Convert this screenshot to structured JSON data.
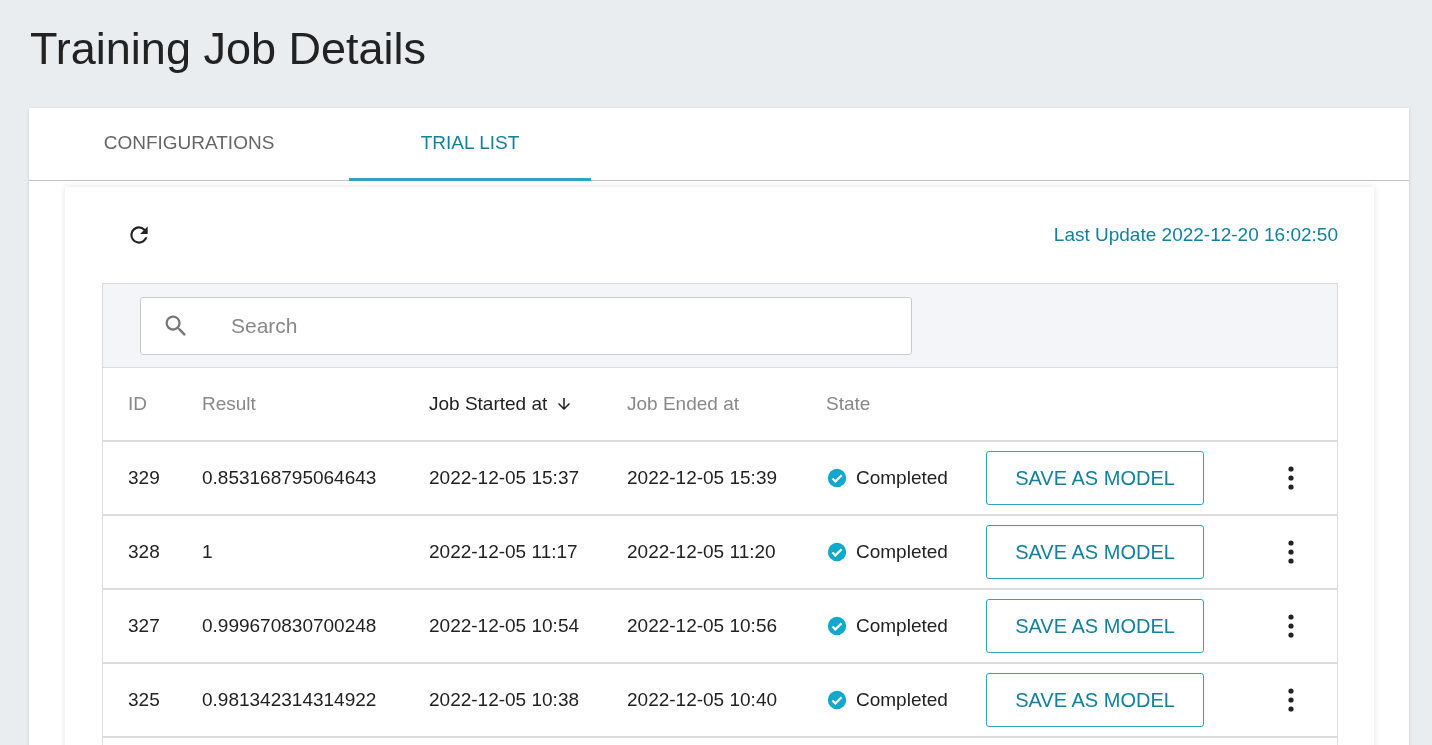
{
  "page": {
    "title": "Training Job Details"
  },
  "tabs": [
    {
      "label": "CONFIGURATIONS",
      "selected": false
    },
    {
      "label": "TRIAL LIST",
      "selected": true
    }
  ],
  "toolbar": {
    "last_update": "Last Update 2022-12-20 16:02:50"
  },
  "search": {
    "placeholder": "Search"
  },
  "table": {
    "columns": [
      {
        "label": "ID",
        "sorted": false
      },
      {
        "label": "Result",
        "sorted": false
      },
      {
        "label": "Job Started at",
        "sorted": true
      },
      {
        "label": "Job Ended at",
        "sorted": false
      },
      {
        "label": "State",
        "sorted": false
      }
    ],
    "rows": [
      {
        "id": "329",
        "result": "0.853168795064643",
        "started": "2022-12-05 15:37",
        "ended": "2022-12-05 15:39",
        "state": "Completed",
        "action": "SAVE AS MODEL"
      },
      {
        "id": "328",
        "result": "1",
        "started": "2022-12-05 11:17",
        "ended": "2022-12-05 11:20",
        "state": "Completed",
        "action": "SAVE AS MODEL"
      },
      {
        "id": "327",
        "result": "0.999670830700248",
        "started": "2022-12-05 10:54",
        "ended": "2022-12-05 10:56",
        "state": "Completed",
        "action": "SAVE AS MODEL"
      },
      {
        "id": "325",
        "result": "0.981342314314922",
        "started": "2022-12-05 10:38",
        "ended": "2022-12-05 10:40",
        "state": "Completed",
        "action": "SAVE AS MODEL"
      }
    ]
  }
}
